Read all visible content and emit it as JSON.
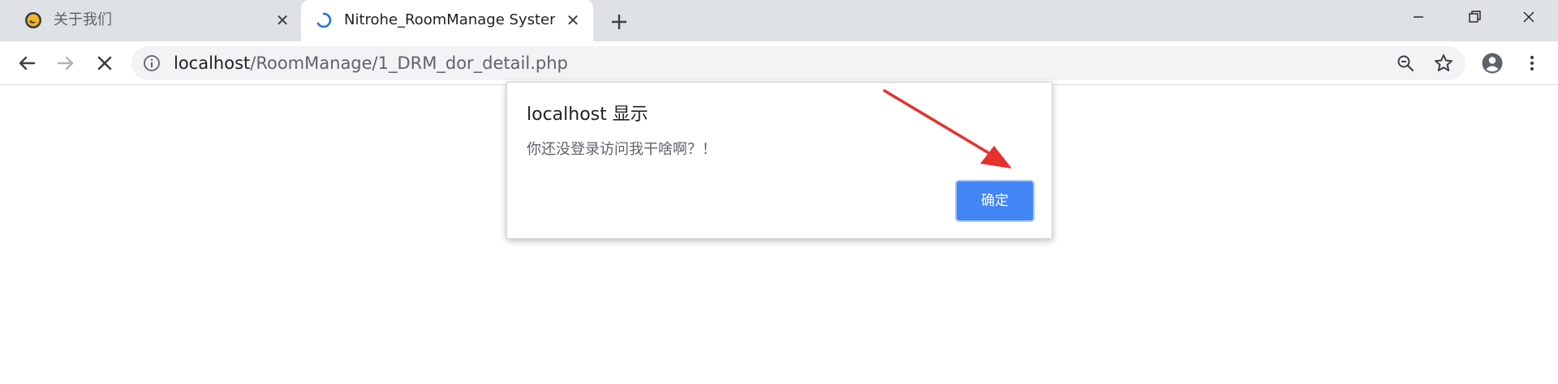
{
  "tabs": [
    {
      "title": "关于我们",
      "icon": "site-favicon"
    },
    {
      "title": "Nitrohe_RoomManage System",
      "icon": "loading-spinner"
    }
  ],
  "toolbar": {
    "url_host": "localhost",
    "url_path": "/RoomManage/1_DRM_dor_detail.php"
  },
  "dialog": {
    "title": "localhost 显示",
    "message": "你还没登录访问我干啥啊？！",
    "ok_label": "确定"
  },
  "colors": {
    "accent": "#4285f4",
    "annotation": "#e8312d"
  }
}
